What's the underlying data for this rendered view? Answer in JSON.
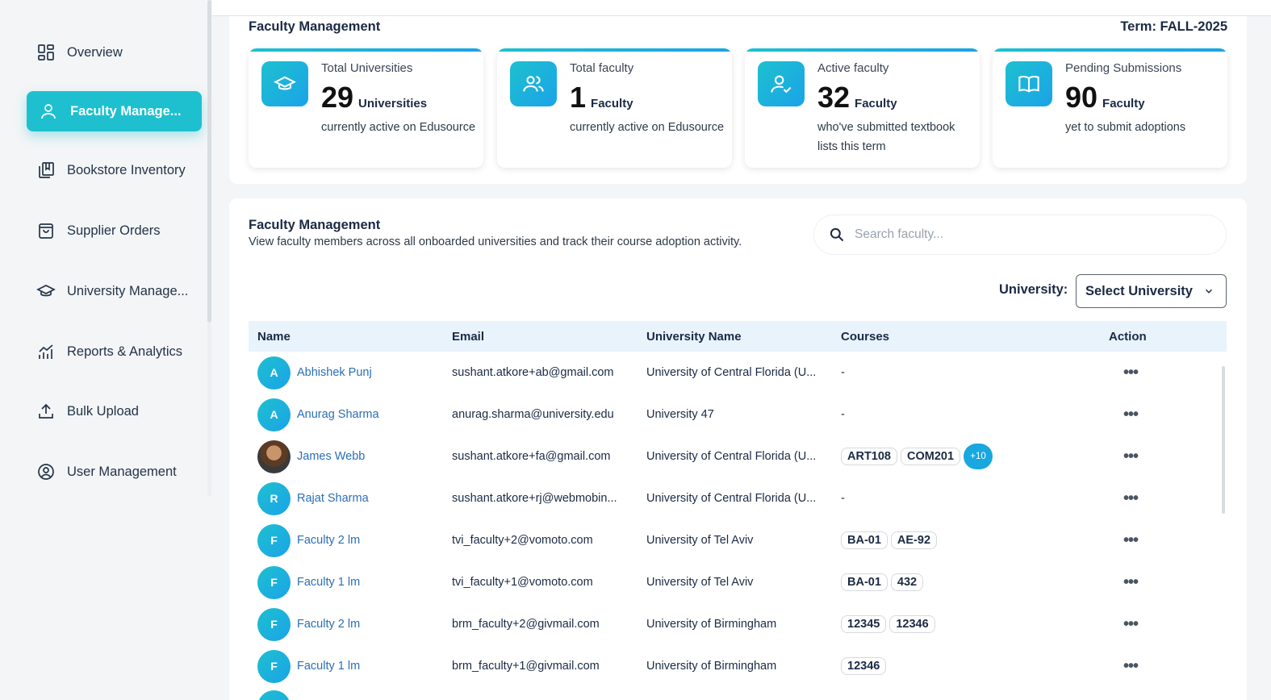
{
  "sidebar": {
    "items": [
      {
        "label": "Overview",
        "icon": "grid-icon"
      },
      {
        "label": "Faculty Manage...",
        "icon": "user-icon",
        "active": true
      },
      {
        "label": "Bookstore Inventory",
        "icon": "books-icon"
      },
      {
        "label": "Supplier Orders",
        "icon": "shopping-bag-icon"
      },
      {
        "label": "University Manage...",
        "icon": "graduation-cap-icon"
      },
      {
        "label": "Reports & Analytics",
        "icon": "chart-icon"
      },
      {
        "label": "Bulk Upload",
        "icon": "upload-icon"
      },
      {
        "label": "User Management",
        "icon": "user-circle-icon"
      }
    ]
  },
  "stats": {
    "title": "Faculty Management",
    "term_label": "Term:",
    "term_value": "FALL-2025",
    "cards": [
      {
        "label": "Total Universities",
        "value": "29",
        "unit": "Universities",
        "desc": "currently active on Edusource",
        "icon": "graduation-cap-icon"
      },
      {
        "label": "Total faculty",
        "value": "1",
        "unit": "Faculty",
        "desc": "currently active on Edusource",
        "icon": "users-icon"
      },
      {
        "label": "Active faculty",
        "value": "32",
        "unit": "Faculty",
        "desc": "who've submitted textbook lists this term",
        "icon": "user-check-icon"
      },
      {
        "label": "Pending Submissions",
        "value": "90",
        "unit": "Faculty",
        "desc": "yet to submit adoptions",
        "icon": "open-book-icon"
      }
    ]
  },
  "list": {
    "title": "Faculty Management",
    "subtitle": "View faculty members across all onboarded universities and track their course adoption activity.",
    "search_placeholder": "Search faculty...",
    "university_label": "University:",
    "university_select": "Select University",
    "columns": [
      "Name",
      "Email",
      "University Name",
      "Courses",
      "Action"
    ],
    "rows": [
      {
        "initial": "A",
        "name": "Abhishek Punj",
        "email": "sushant.atkore+ab@gmail.com",
        "university": "University of Central Florida (U...",
        "courses": [],
        "none": "-"
      },
      {
        "initial": "A",
        "name": "Anurag Sharma",
        "email": "anurag.sharma@university.edu",
        "university": "University 47",
        "courses": [],
        "none": "-"
      },
      {
        "initial": "",
        "photo": true,
        "name": "James Webb",
        "email": "sushant.atkore+fa@gmail.com",
        "university": "University of Central Florida (U...",
        "courses": [
          "ART108",
          "COM201"
        ],
        "more": "+10"
      },
      {
        "initial": "R",
        "name": "Rajat Sharma",
        "email": "sushant.atkore+rj@webmobin...",
        "university": "University of Central Florida (U...",
        "courses": [],
        "none": "-"
      },
      {
        "initial": "F",
        "name": "Faculty 2 lm",
        "email": "tvi_faculty+2@vomoto.com",
        "university": "University of Tel Aviv",
        "courses": [
          "BA-01",
          "AE-92"
        ]
      },
      {
        "initial": "F",
        "name": "Faculty 1 lm",
        "email": "tvi_faculty+1@vomoto.com",
        "university": "University of Tel Aviv",
        "courses": [
          "BA-01",
          "432"
        ]
      },
      {
        "initial": "F",
        "name": "Faculty 2 lm",
        "email": "brm_faculty+2@givmail.com",
        "university": "University of Birmingham",
        "courses": [
          "12345",
          "12346"
        ]
      },
      {
        "initial": "F",
        "name": "Faculty 1 lm",
        "email": "brm_faculty+1@givmail.com",
        "university": "University of Birmingham",
        "courses": [
          "12346"
        ]
      }
    ],
    "action_glyph": "•••"
  },
  "colors": {
    "accent": "#1ec0cf",
    "accent2": "#1aa3e8",
    "link": "#2a6fb5"
  }
}
